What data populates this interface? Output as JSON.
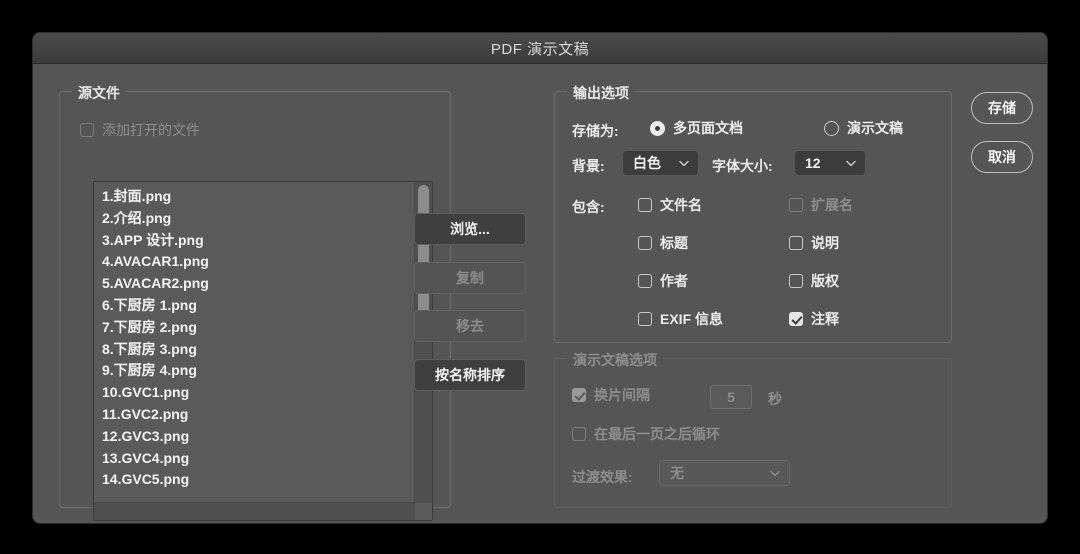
{
  "window": {
    "title": "PDF 演示文稿"
  },
  "source_group": {
    "legend": "源文件",
    "add_open_files": {
      "label": "添加打开的文件",
      "checked": false,
      "enabled": false
    },
    "files": [
      "1.封面.png",
      "2.介绍.png",
      "3.APP 设计.png",
      "4.AVACAR1.png",
      "5.AVACAR2.png",
      "6.下厨房 1.png",
      "7.下厨房 2.png",
      "8.下厨房 3.png",
      "9.下厨房 4.png",
      "10.GVC1.png",
      "11.GVC2.png",
      "12.GVC3.png",
      "13.GVC4.png",
      "14.GVC5.png"
    ],
    "buttons": [
      {
        "label": "浏览...",
        "enabled": true
      },
      {
        "label": "复制",
        "enabled": false
      },
      {
        "label": "移去",
        "enabled": false
      },
      {
        "label": "按名称排序",
        "enabled": true
      }
    ]
  },
  "output_group": {
    "legend": "输出选项",
    "save_as_label": "存储为:",
    "save_as_options": [
      {
        "label": "多页面文档",
        "selected": true
      },
      {
        "label": "演示文稿",
        "selected": false
      }
    ],
    "background_label": "背景:",
    "background_value": "白色",
    "font_size_label": "字体大小:",
    "font_size_value": "12",
    "include_label": "包含:",
    "include_options": [
      {
        "label": "文件名",
        "checked": false,
        "enabled": true
      },
      {
        "label": "扩展名",
        "checked": false,
        "enabled": false
      },
      {
        "label": "标题",
        "checked": false,
        "enabled": true
      },
      {
        "label": "说明",
        "checked": false,
        "enabled": true
      },
      {
        "label": "作者",
        "checked": false,
        "enabled": true
      },
      {
        "label": "版权",
        "checked": false,
        "enabled": true
      },
      {
        "label": "EXIF 信息",
        "checked": false,
        "enabled": true
      },
      {
        "label": "注释",
        "checked": true,
        "enabled": true
      }
    ]
  },
  "presentation_group": {
    "legend": "演示文稿选项",
    "enabled": false,
    "advance_every": {
      "label": "换片间隔",
      "checked": true,
      "value": "5",
      "unit": "秒"
    },
    "loop_after_last": {
      "label": "在最后一页之后循环",
      "checked": false
    },
    "transition_label": "过渡效果:",
    "transition_value": "无"
  },
  "actions": {
    "save_label": "存储",
    "cancel_label": "取消"
  },
  "colors": {
    "dialog_bg": "#555555",
    "titlebar_bg": "#434343",
    "list_bg": "#5a5a5a",
    "text": "#ececec",
    "disabled_text": "#8d8d8d"
  }
}
